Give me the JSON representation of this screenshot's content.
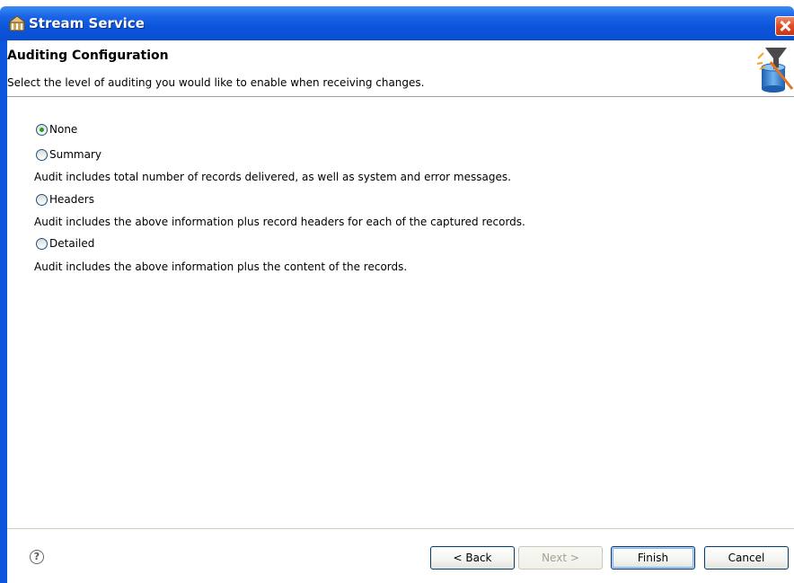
{
  "window": {
    "title": "Stream Service",
    "title_icon": "stream-service-icon",
    "close_icon": "close-icon"
  },
  "header": {
    "title": "Auditing Configuration",
    "description": "Select the level of auditing you would like to enable when receiving changes.",
    "icon": "wizard-banner-icon"
  },
  "options": [
    {
      "label": "None",
      "checked": true,
      "description": ""
    },
    {
      "label": "Summary",
      "checked": false,
      "description": "Audit includes total number of records delivered, as well as system and error messages."
    },
    {
      "label": "Headers",
      "checked": false,
      "description": "Audit includes the above information plus record headers for each of the captured records."
    },
    {
      "label": "Detailed",
      "checked": false,
      "description": "Audit includes the above information plus the content of the records."
    }
  ],
  "footer": {
    "help_icon": "help-icon",
    "help_glyph": "?",
    "back_label": "< Back",
    "next_label": "Next >",
    "finish_label": "Finish",
    "cancel_label": "Cancel"
  },
  "colors": {
    "titlebar": "#0b55db",
    "radio_checked": "#21a121",
    "close_button": "#e04a22"
  }
}
